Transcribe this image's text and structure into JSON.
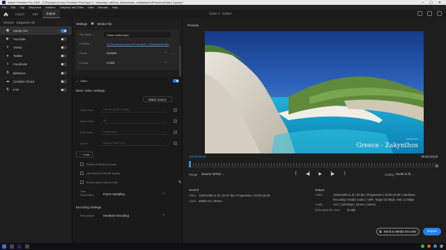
{
  "window": {
    "title": "Adobe Premiere Pro 2022 - D:\\Escritorio\\Curso Premiere Pro\\Clase 3 - Velocidad, efectos, transiciones, subtitulación\\Premiere\\Clase 3.prproj *"
  },
  "menu": [
    "File",
    "Edit",
    "Clip",
    "Sequence",
    "Markers",
    "Graphics and Titles",
    "View",
    "Window",
    "Help"
  ],
  "workspace": {
    "tabs": [
      "Import",
      "Edit",
      "Export"
    ],
    "active_tab": "Export",
    "center_title": "Clase 3 - Edited"
  },
  "source": {
    "label": "Source:",
    "value": "Sequence 02"
  },
  "destinations": [
    {
      "label": "Media File",
      "icon": "media-file-icon",
      "active": true,
      "enabled": true
    },
    {
      "label": "YouTube",
      "icon": "youtube-icon",
      "active": false,
      "enabled": false
    },
    {
      "label": "Vimeo",
      "icon": "vimeo-icon",
      "active": false,
      "enabled": false
    },
    {
      "label": "Twitter",
      "icon": "twitter-icon",
      "active": false,
      "enabled": false
    },
    {
      "label": "Facebook",
      "icon": "facebook-icon",
      "active": false,
      "enabled": false
    },
    {
      "label": "Behance",
      "icon": "behance-icon",
      "active": false,
      "enabled": false
    },
    {
      "label": "Creative Cloud",
      "icon": "creative-cloud-icon",
      "active": false,
      "enabled": false
    },
    {
      "label": "FTP",
      "icon": "ftp-icon",
      "active": false,
      "enabled": false
    }
  ],
  "settings": {
    "header": "Settings",
    "section_title": "Media File",
    "file_name_label": "File Name",
    "file_name": "Clase render.mp4",
    "location_label": "Location",
    "location": "D:\\Escritorio\\Curso de Premiere\\...\\Render\\Render",
    "preset_label": "Preset",
    "preset": "Custom",
    "format_label": "Format",
    "format": "H.264",
    "video_section": "Video",
    "basic_video_settings": "Basic Video Settings",
    "match_source": "Match Source",
    "frame_size_label": "Frame Size",
    "frame_size": "Full HD (1920 x 1080)",
    "frame_rate_label": "Frame Rate",
    "frame_rate": "30",
    "field_order_label": "Field Order",
    "field_order": "Progressive",
    "aspect_label": "Aspect",
    "aspect": "Square Pixels (1.0)",
    "less": "Less",
    "render_max_depth": "Render at Maximum Depth",
    "use_max_render_quality": "Use Maximum Render Quality",
    "render_alpha": "Render Alpha Channel Only",
    "time_interp_label": "Time Interpolation",
    "time_interp": "Frame Sampling",
    "encoding_settings": "Encoding Settings",
    "performance_label": "Performance",
    "performance": "Hardware Encoding"
  },
  "preview": {
    "title": "Preview",
    "caption": "Greece - Zakynthos",
    "caption_small": "Navagio Beach",
    "timecode_start": "00;00;00;00",
    "timecode_end": "00;00;18;29",
    "range_label": "Range",
    "range_value": "Source In/Out",
    "scaling_label": "Scaling",
    "scaling_value": "Scale to fit"
  },
  "source_info": {
    "header": "Source",
    "video_key": "Video",
    "video": "1920x1080 (1.0)  |  29.97 fps  |  Progressive  |  00;00;18;29",
    "audio_key": "Audio",
    "audio": "48000 Hz  |  Stereo"
  },
  "output_info": {
    "header": "Output",
    "video_key": "Video",
    "video": "1920x1080 (1.0)  |  30 fps  |  Progressive  |  00;00;18;29  |  Hardware",
    "encoding": "Encoding  |  Nvidia Codec  |  VBR, Target 10 Mbps, Max 12 Mbps",
    "audio_key": "Audio",
    "audio": "AAC  |  320 kbps  |  48 kHz  |  Stereo",
    "size_key": "Estimated File Size",
    "size": "44 MB"
  },
  "footer": {
    "send_label": "Send to Media Encoder",
    "export_label": "Export"
  },
  "colors": {
    "accent": "#2680eb",
    "timecode": "#2f8fea"
  }
}
